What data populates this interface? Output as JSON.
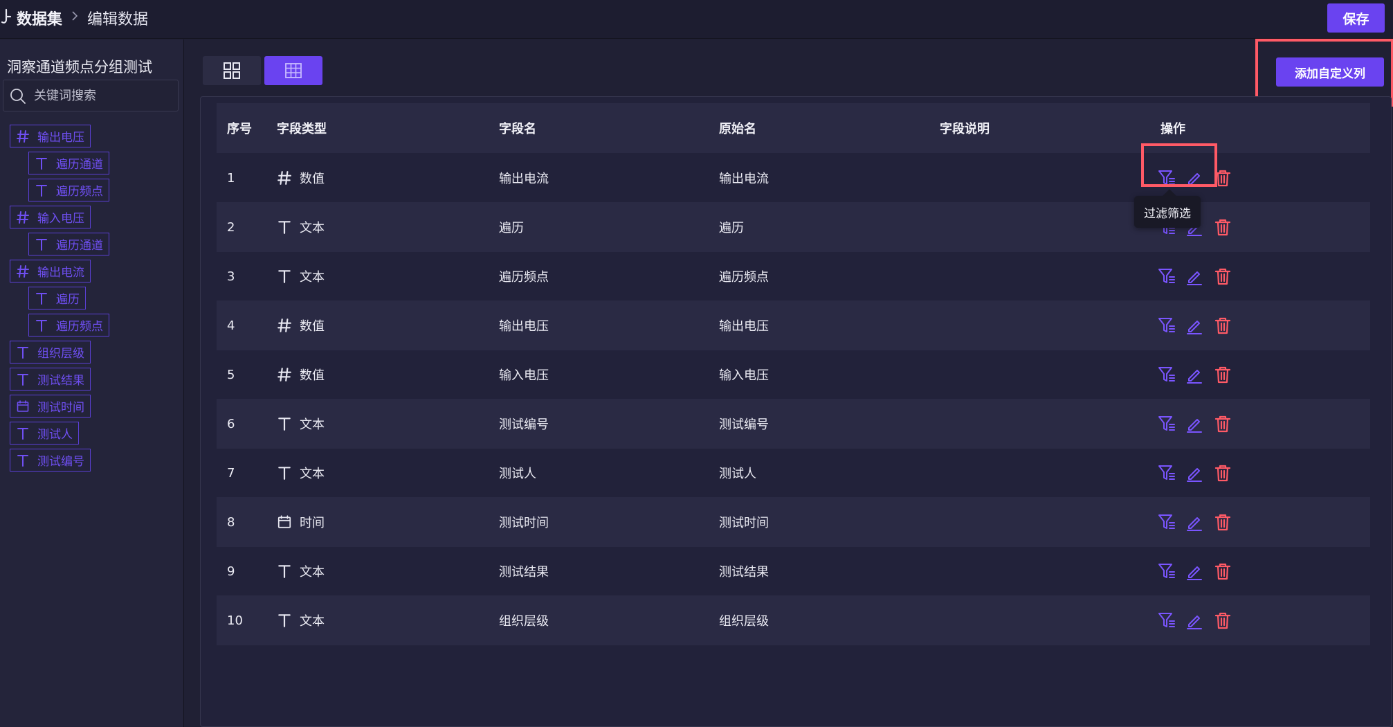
{
  "header": {
    "breadcrumb_root": "数据集",
    "breadcrumb_current": "编辑数据",
    "save_label": "保存"
  },
  "sidebar": {
    "dataset_title": "洞察通道频点分组测试",
    "search_placeholder": "关键词搜索",
    "fields": [
      {
        "label": "输出电压",
        "type": "number",
        "level": 0
      },
      {
        "label": "遍历通道",
        "type": "text",
        "level": 1
      },
      {
        "label": "遍历频点",
        "type": "text",
        "level": 1
      },
      {
        "label": "输入电压",
        "type": "number",
        "level": 0
      },
      {
        "label": "遍历通道",
        "type": "text",
        "level": 1
      },
      {
        "label": "输出电流",
        "type": "number",
        "level": 0
      },
      {
        "label": "遍历",
        "type": "text",
        "level": 1
      },
      {
        "label": "遍历频点",
        "type": "text",
        "level": 1
      },
      {
        "label": "组织层级",
        "type": "text",
        "level": 0
      },
      {
        "label": "测试结果",
        "type": "text",
        "level": 0
      },
      {
        "label": "测试时间",
        "type": "date",
        "level": 0
      },
      {
        "label": "测试人",
        "type": "text",
        "level": 0
      },
      {
        "label": "测试编号",
        "type": "text",
        "level": 0
      }
    ]
  },
  "toolbar": {
    "add_column_label": "添加自定义列"
  },
  "table": {
    "headers": {
      "index": "序号",
      "type": "字段类型",
      "name": "字段名",
      "original": "原始名",
      "description": "字段说明",
      "ops": "操作"
    },
    "rows": [
      {
        "index": "1",
        "type_icon": "number-icon",
        "type": "数值",
        "name": "输出电流",
        "original": "输出电流",
        "description": ""
      },
      {
        "index": "2",
        "type_icon": "text-icon",
        "type": "文本",
        "name": "遍历",
        "original": "遍历",
        "description": ""
      },
      {
        "index": "3",
        "type_icon": "text-icon",
        "type": "文本",
        "name": "遍历频点",
        "original": "遍历频点",
        "description": ""
      },
      {
        "index": "4",
        "type_icon": "number-icon",
        "type": "数值",
        "name": "输出电压",
        "original": "输出电压",
        "description": ""
      },
      {
        "index": "5",
        "type_icon": "number-icon",
        "type": "数值",
        "name": "输入电压",
        "original": "输入电压",
        "description": ""
      },
      {
        "index": "6",
        "type_icon": "text-icon",
        "type": "文本",
        "name": "测试编号",
        "original": "测试编号",
        "description": ""
      },
      {
        "index": "7",
        "type_icon": "text-icon",
        "type": "文本",
        "name": "测试人",
        "original": "测试人",
        "description": ""
      },
      {
        "index": "8",
        "type_icon": "calendar-icon",
        "type": "时间",
        "name": "测试时间",
        "original": "测试时间",
        "description": ""
      },
      {
        "index": "9",
        "type_icon": "text-icon",
        "type": "文本",
        "name": "测试结果",
        "original": "测试结果",
        "description": ""
      },
      {
        "index": "10",
        "type_icon": "text-icon",
        "type": "文本",
        "name": "组织层级",
        "original": "组织层级",
        "description": ""
      }
    ],
    "tooltip_text": "过滤筛选"
  },
  "colors": {
    "accent": "#6a43f0",
    "danger": "#ff5a66",
    "background": "#202034"
  }
}
